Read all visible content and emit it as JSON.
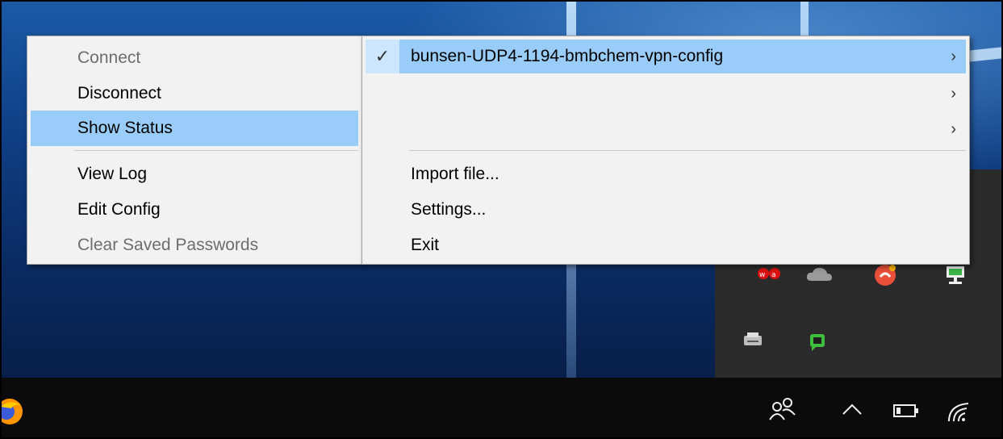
{
  "left_menu": {
    "items": [
      {
        "label": "Connect",
        "disabled": true
      },
      {
        "label": "Disconnect",
        "disabled": false
      },
      {
        "label": "Show Status",
        "highlighted": true
      }
    ],
    "items2": [
      {
        "label": "View Log"
      },
      {
        "label": "Edit Config"
      },
      {
        "label": "Clear Saved Passwords",
        "disabled": true
      }
    ]
  },
  "right_menu": {
    "profiles": [
      {
        "label": "bunsen-UDP4-1194-bmbchem-vpn-config",
        "checked": true,
        "highlighted": true
      },
      {
        "label": ""
      },
      {
        "label": ""
      }
    ],
    "actions": [
      {
        "label": "Import file..."
      },
      {
        "label": "Settings..."
      },
      {
        "label": "Exit"
      }
    ]
  },
  "icons": {
    "check": "✓",
    "chevron": "›"
  },
  "colors": {
    "highlight": "#99ccf8",
    "menu_bg": "#f2f2f2",
    "disabled_text": "#6d6d6d"
  }
}
